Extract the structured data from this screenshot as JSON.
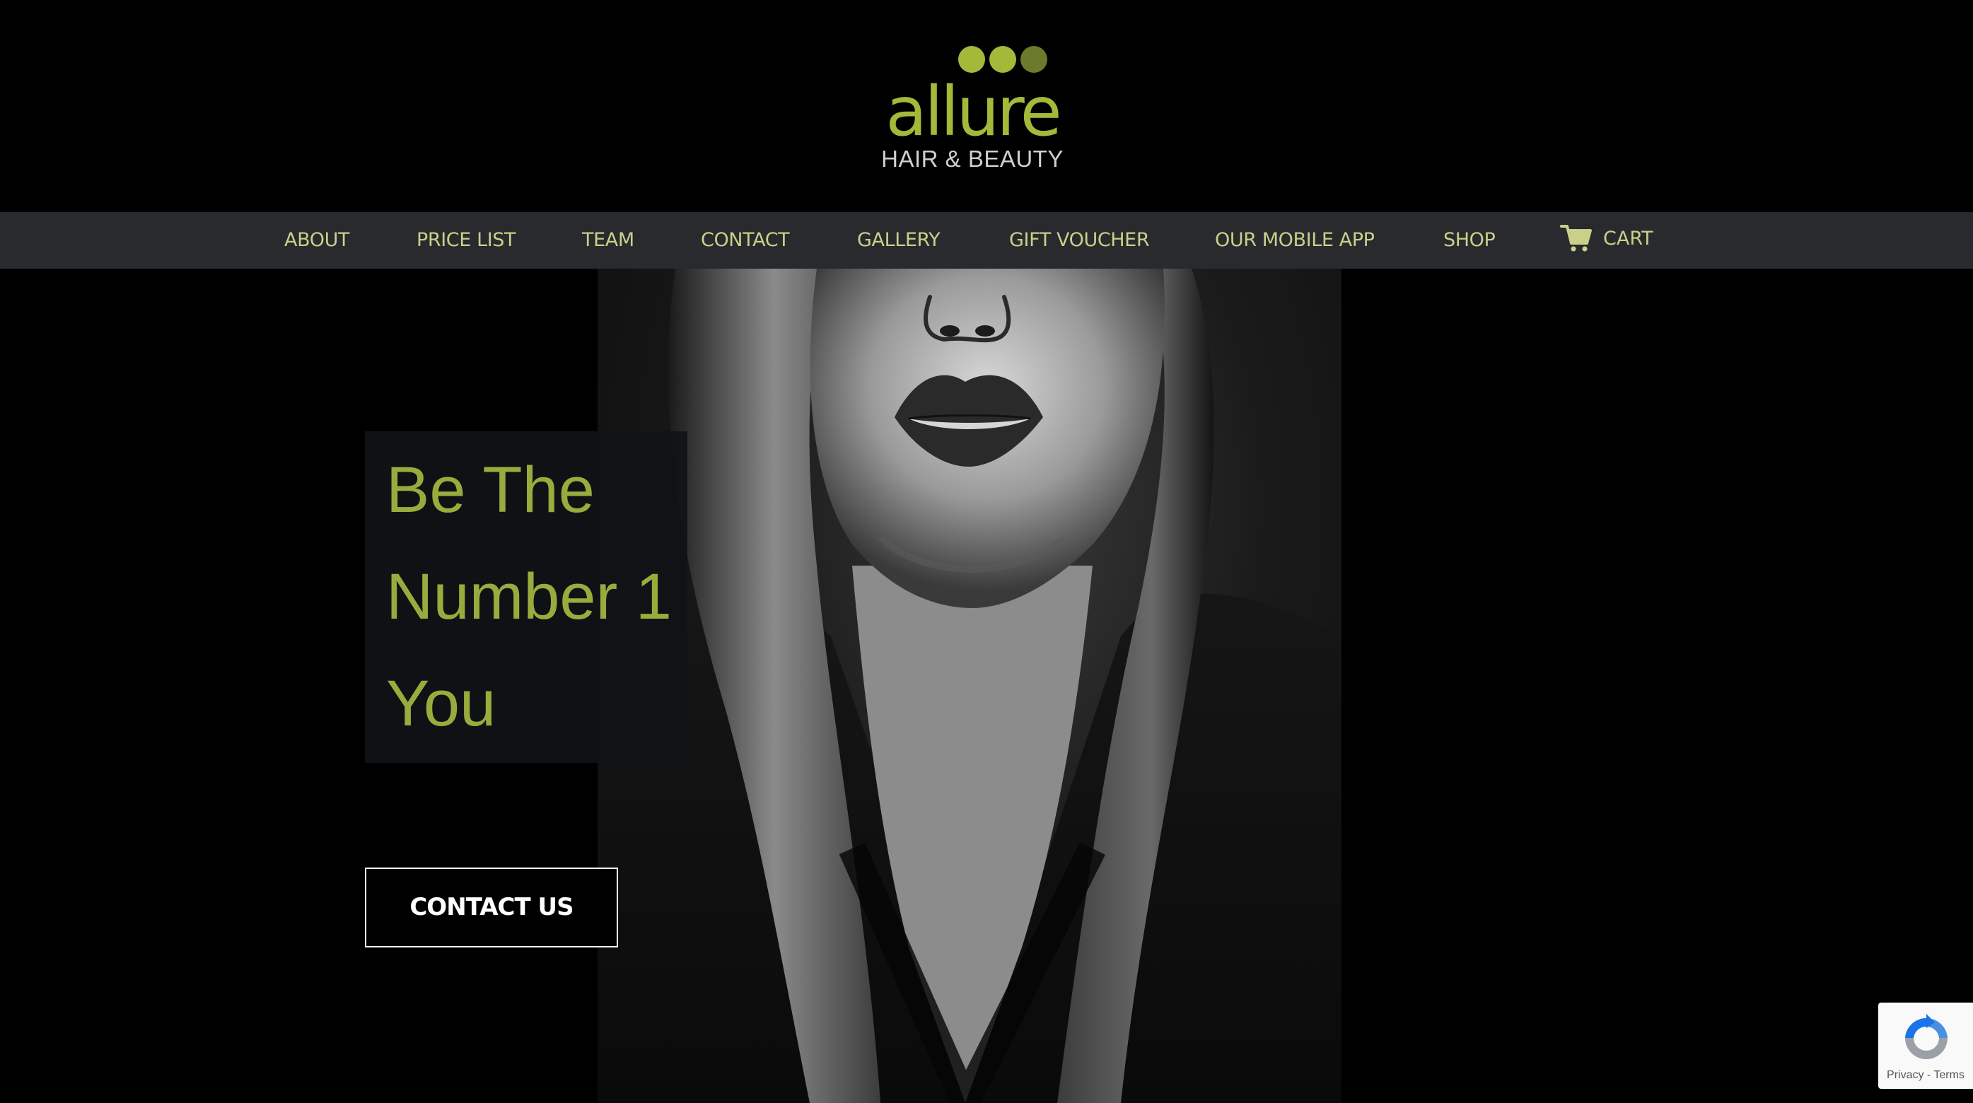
{
  "colors": {
    "brand_green": "#a4b83a",
    "brand_green_dark": "#6c7a2c",
    "headline_green": "#9aab3e",
    "nav_text": "#c9d08a",
    "nav_bg": "#282a2d",
    "logo_tag_grey": "#cfcfcf"
  },
  "logo": {
    "word": "allure",
    "tagline": "HAIR & BEAUTY"
  },
  "nav": {
    "items": [
      {
        "label": "ABOUT"
      },
      {
        "label": "PRICE LIST"
      },
      {
        "label": "TEAM"
      },
      {
        "label": "CONTACT"
      },
      {
        "label": "GALLERY"
      },
      {
        "label": "GIFT VOUCHER"
      },
      {
        "label": "OUR MOBILE APP"
      },
      {
        "label": "SHOP"
      }
    ],
    "cart": {
      "label": "CART",
      "icon": "cart-icon"
    }
  },
  "hero": {
    "headline": [
      "Be The",
      "Number 1",
      "You"
    ],
    "cta_label": "CONTACT US"
  },
  "recaptcha": {
    "privacy": "Privacy",
    "separator": " - ",
    "terms": "Terms",
    "icon": "recaptcha-icon"
  }
}
